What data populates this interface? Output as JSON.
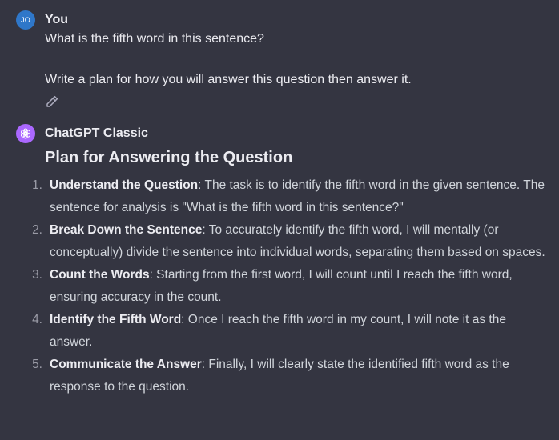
{
  "user_message": {
    "avatar_initials": "JO",
    "author": "You",
    "line1": "What is the fifth word in this sentence?",
    "line2": "Write a plan for how you will answer this question then answer it.",
    "edit_icon": "pencil-edit-icon"
  },
  "assistant_message": {
    "avatar_icon": "openai-logo-icon",
    "author": "ChatGPT Classic",
    "heading": "Plan for Answering the Question",
    "steps": [
      {
        "number": "1.",
        "title": "Understand the Question",
        "text": ": The task is to identify the fifth word in the given sentence. The sentence for analysis is \"What is the fifth word in this sentence?\""
      },
      {
        "number": "2.",
        "title": "Break Down the Sentence",
        "text": ": To accurately identify the fifth word, I will mentally (or conceptually) divide the sentence into individual words, separating them based on spaces."
      },
      {
        "number": "3.",
        "title": "Count the Words",
        "text": ": Starting from the first word, I will count until I reach the fifth word, ensuring accuracy in the count."
      },
      {
        "number": "4.",
        "title": "Identify the Fifth Word",
        "text": ": Once I reach the fifth word in my count, I will note it as the answer."
      },
      {
        "number": "5.",
        "title": "Communicate the Answer",
        "text": ": Finally, I will clearly state the identified fifth word as the response to the question."
      }
    ]
  },
  "colors": {
    "background": "#343541",
    "user_avatar": "#2f77c9",
    "bot_avatar": "#ab68ff",
    "text_primary": "#ececf1",
    "text_secondary": "#d1d5db"
  }
}
